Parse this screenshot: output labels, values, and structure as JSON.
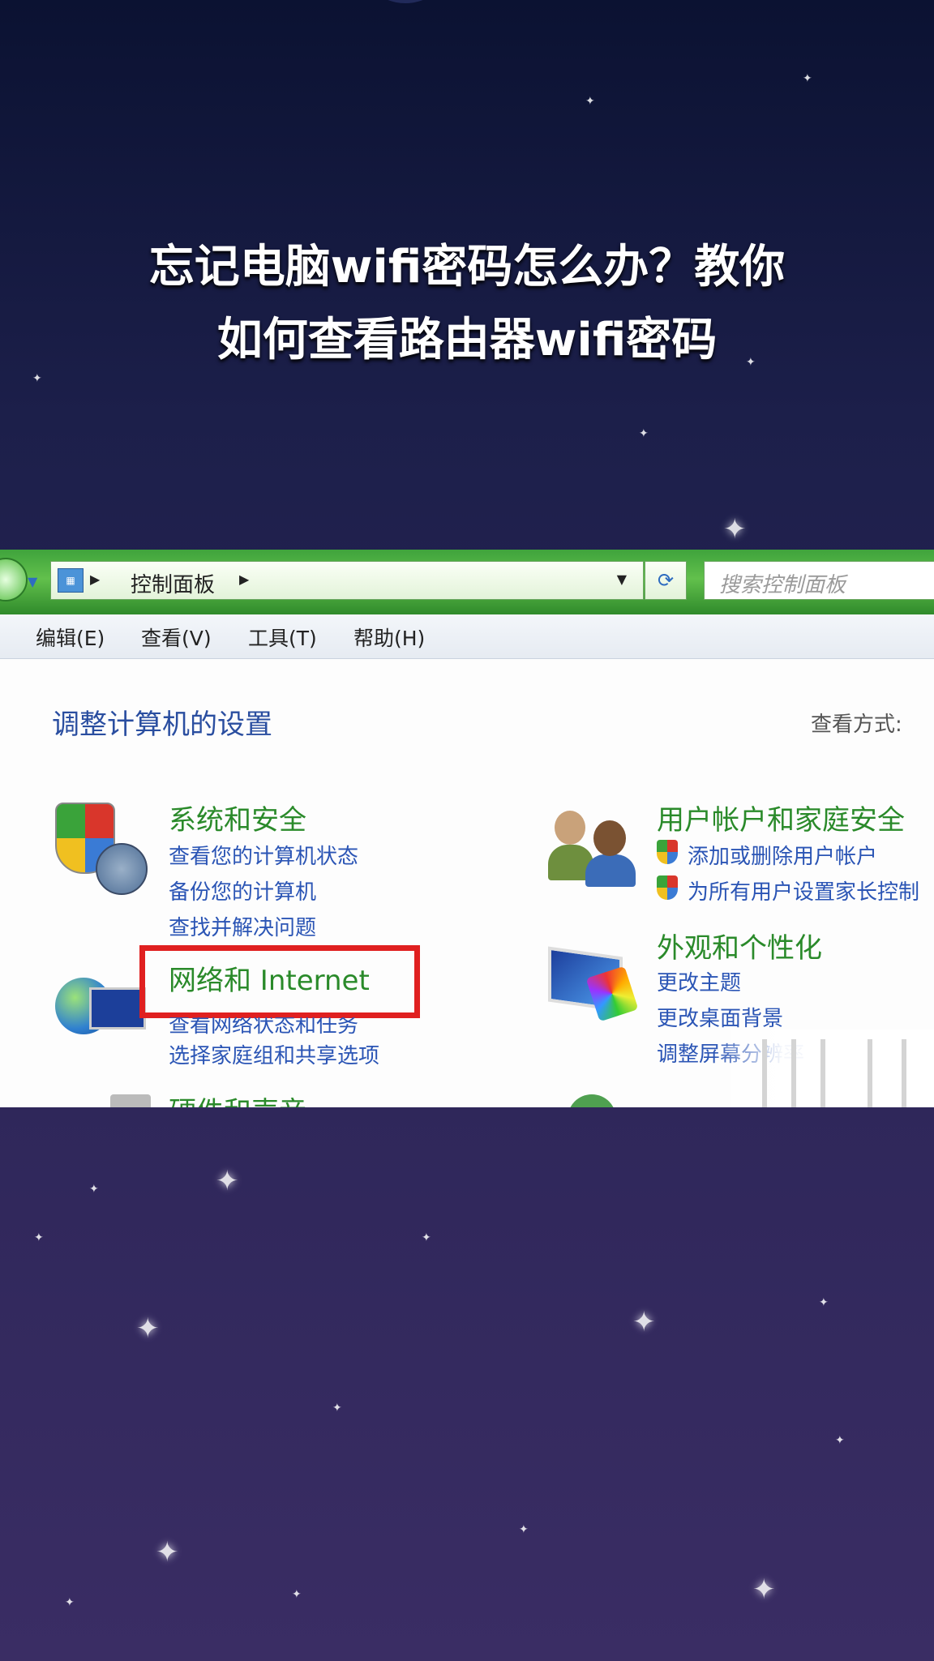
{
  "title": {
    "line1": "忘记电脑wifi密码怎么办？教你",
    "line2": "如何查看路由器wifi密码"
  },
  "window": {
    "breadcrumb": "控制面板",
    "search_placeholder": "搜索控制面板",
    "menu": [
      "编辑(E)",
      "查看(V)",
      "工具(T)",
      "帮助(H)"
    ],
    "heading": "调整计算机的设置",
    "view_by": "查看方式:",
    "categories": {
      "system_security": {
        "title": "系统和安全",
        "links": [
          "查看您的计算机状态",
          "备份您的计算机",
          "查找并解决问题"
        ]
      },
      "network": {
        "title": "网络和 Internet",
        "links": [
          "查看网络状态和任务",
          "选择家庭组和共享选项"
        ]
      },
      "hardware": {
        "title": "硬件和声音"
      },
      "user_accounts": {
        "title": "用户帐户和家庭安全",
        "links": [
          "添加或删除用户帐户",
          "为所有用户设置家长控制"
        ]
      },
      "appearance": {
        "title": "外观和个性化",
        "links": [
          "更改主题",
          "更改桌面背景",
          "调整屏幕分辨率"
        ]
      }
    },
    "highlight_color": "#e02020",
    "category_color": "#2a8a2a",
    "link_color": "#2b55b5"
  }
}
